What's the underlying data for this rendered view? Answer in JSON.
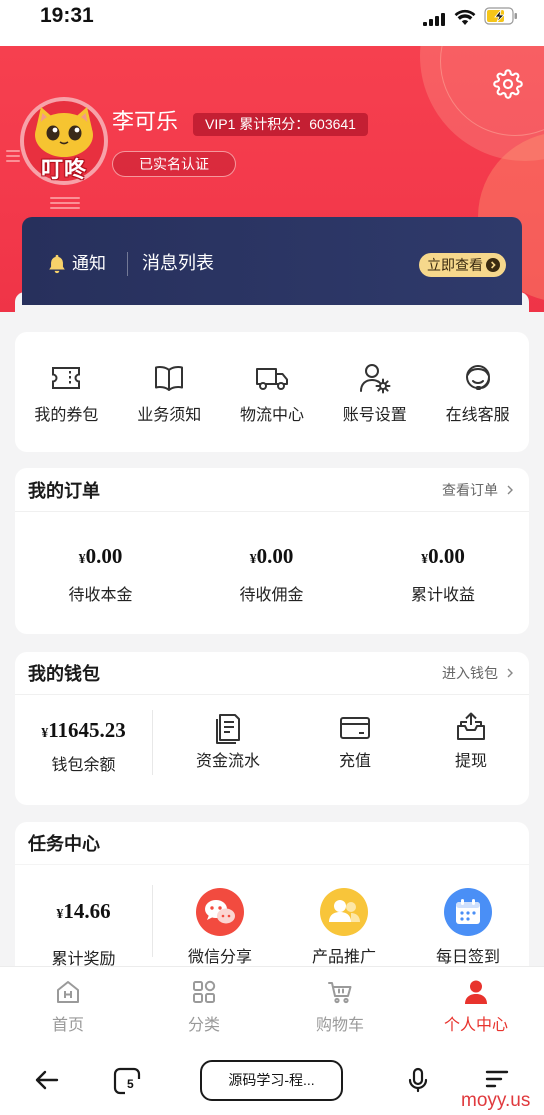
{
  "status_bar": {
    "time": "19:31"
  },
  "profile": {
    "avatar_text": "叮咚",
    "name": "李可乐",
    "vip_badge": "VIP1 累计积分：603641",
    "verified_label": "已实名认证",
    "settings_icon": "gear-icon"
  },
  "notice": {
    "icon": "bell-icon",
    "label": "通知",
    "title": "消息列表",
    "button_label": "立即查看"
  },
  "shortcuts": [
    {
      "label": "我的券包",
      "icon": "ticket-icon"
    },
    {
      "label": "业务须知",
      "icon": "book-icon"
    },
    {
      "label": "物流中心",
      "icon": "truck-icon"
    },
    {
      "label": "账号设置",
      "icon": "user-settings-icon"
    },
    {
      "label": "在线客服",
      "icon": "customer-service-icon"
    }
  ],
  "orders": {
    "title": "我的订单",
    "link_label": "查看订单",
    "stats": [
      {
        "currency": "¥",
        "amount": "0.00",
        "label": "待收本金"
      },
      {
        "currency": "¥",
        "amount": "0.00",
        "label": "待收佣金"
      },
      {
        "currency": "¥",
        "amount": "0.00",
        "label": "累计收益"
      }
    ]
  },
  "wallet": {
    "title": "我的钱包",
    "link_label": "进入钱包",
    "balance": {
      "currency": "¥",
      "amount": "11645.23",
      "label": "钱包余额"
    },
    "actions": [
      {
        "label": "资金流水",
        "icon": "transaction-record-icon"
      },
      {
        "label": "充值",
        "icon": "bank-card-icon"
      },
      {
        "label": "提现",
        "icon": "withdraw-icon"
      }
    ]
  },
  "tasks": {
    "title": "任务中心",
    "reward": {
      "currency": "¥",
      "amount": "14.66",
      "label": "累计奖励"
    },
    "actions": [
      {
        "label": "微信分享",
        "icon": "wechat-icon",
        "color": "#f24b3f"
      },
      {
        "label": "产品推广",
        "icon": "people-icon",
        "color": "#f8c53a"
      },
      {
        "label": "每日签到",
        "icon": "calendar-icon",
        "color": "#4a8ff6"
      }
    ]
  },
  "tab_bar": {
    "tabs": [
      {
        "label": "首页",
        "icon": "home-icon",
        "active": false
      },
      {
        "label": "分类",
        "icon": "category-icon",
        "active": false
      },
      {
        "label": "购物车",
        "icon": "cart-icon",
        "active": false
      },
      {
        "label": "个人中心",
        "icon": "user-icon",
        "active": true
      }
    ]
  },
  "browser": {
    "address": "源码学习-程...",
    "tab_count": "5"
  },
  "watermark": "moyy.us",
  "colors": {
    "accent": "#e8332d",
    "header": "#f43a4b",
    "notice_bg": "#2b3460",
    "notice_button": "#f6d88c",
    "page_bg": "#f4f4f5"
  }
}
